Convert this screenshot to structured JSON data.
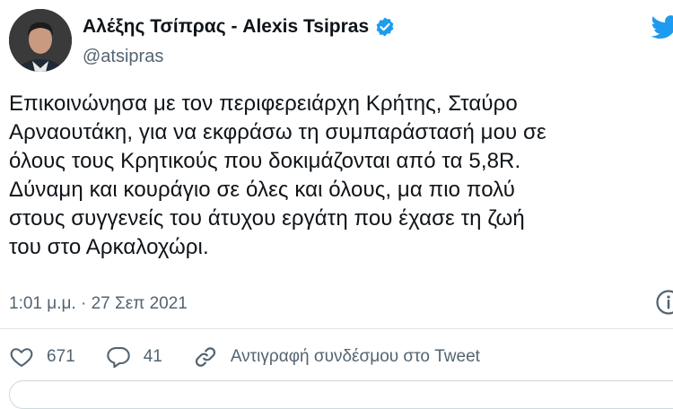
{
  "author": {
    "display_name": "Αλέξης Τσίπρας - Alexis Tsipras",
    "handle": "@atsipras",
    "verified_icon": "verified-badge-icon",
    "brand_color": "#1d9bf0"
  },
  "tweet": {
    "lines": [
      "Επικοινώνησα με τον περιφερειάρχη Κρήτης, Σταύρο",
      "Αρναουτάκη, για να εκφράσω τη συμπαράστασή μου σε",
      "όλους τους Κρητικούς που δοκιμάζονται από τα 5,8R.",
      "Δύναμη και κουράγιο σε όλες και όλους, μα πιο πολύ",
      "στους συγγενείς του άτυχου εργάτη που έχασε τη ζωή",
      "του στο Αρκαλοχώρι."
    ],
    "timestamp": "1:01 μ.μ. · 27 Σεπ 2021"
  },
  "actions": {
    "likes": "671",
    "replies": "41",
    "copy_link": "Αντιγραφή συνδέσμου στο Tweet"
  },
  "colors": {
    "text": "#0f1419",
    "secondary": "#536471",
    "accent": "#1d9bf0"
  }
}
